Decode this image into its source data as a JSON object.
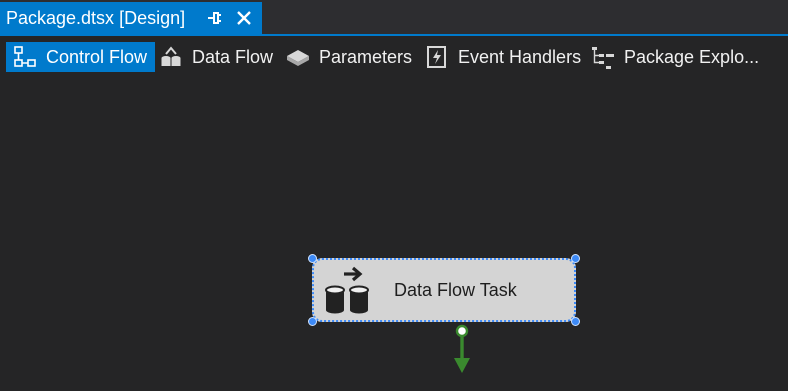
{
  "document_tab": {
    "title": "Package.dtsx [Design]",
    "pin_icon": "pin-icon",
    "close_icon": "close-icon"
  },
  "designer_tabs": [
    {
      "label": "Control Flow",
      "icon": "control-flow-icon",
      "active": true
    },
    {
      "label": "Data Flow",
      "icon": "data-flow-icon",
      "active": false
    },
    {
      "label": "Parameters",
      "icon": "parameters-icon",
      "active": false
    },
    {
      "label": "Event Handlers",
      "icon": "event-handlers-icon",
      "active": false
    },
    {
      "label": "Package Explo...",
      "icon": "package-explorer-icon",
      "active": false
    }
  ],
  "canvas": {
    "task": {
      "label": "Data Flow Task",
      "icon": "data-flow-task-icon",
      "selected": true
    },
    "precedence_constraint": {
      "color": "#3a8a2e",
      "icon": "green-arrow-icon"
    }
  },
  "colors": {
    "accent": "#007acc",
    "background": "#252526",
    "selection": "#3d8af7",
    "task_fill": "#d4d4d4"
  }
}
